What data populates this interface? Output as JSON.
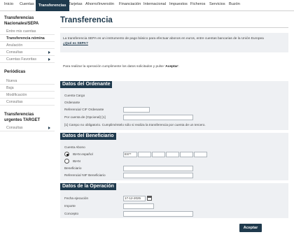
{
  "topnav": {
    "items": [
      "Inicio",
      "Cuentas",
      "Transferencias",
      "Tarjetas",
      "Ahorro/Inversión",
      "Financiación",
      "Internacional",
      "Impuestos",
      "Ficheros",
      "Servicios",
      "Buzón"
    ],
    "active": "Transferencias"
  },
  "sidebar": {
    "group1_title": "Transferencias Nacionales/SEPA",
    "group1_items": [
      "Entre mis cuentas",
      "Transferencia nómina",
      "Anulación",
      "Consultas",
      "Cuentas Favoritas"
    ],
    "group2_title": "Periódicas",
    "group2_items": [
      "Nueva",
      "Baja",
      "Modificación",
      "Consultas"
    ],
    "group3_title": "Transferencias urgentes TARGET",
    "group3_items": [
      "Consultas"
    ]
  },
  "main": {
    "title": "Transferencia",
    "info_text": "La transferencia SEPA es un instrumento de pago básico para efectuar abonos en euros, entre cuentas bancarias de la Unión Europea",
    "info_link": "¿Qué es SEPA?",
    "instruction_prefix": "Para realizar la operación cumplimente los datos solicitados y pulse ",
    "instruction_action": "Aceptar"
  },
  "ordenante": {
    "heading": "Datos del Ordenante",
    "cuenta_cargo_label": "Cuenta Cargo",
    "ordenante_label": "Ordenante",
    "referencia_label": "Referencia/ CIF Ordenante",
    "por_cuenta_label": "Por cuenta de (Opcional) [1]",
    "note": "[1] Campo no obligatorio. Cumpliméntelo sólo si realiza la transferencia por cuenta de un tercero."
  },
  "beneficiario": {
    "heading": "Datos del Beneficiario",
    "cuenta_abono_label": "Cuenta Abono",
    "iban_es_label": "IBAN español",
    "iban_label": "IBAN",
    "iban_prefix": "ES**",
    "beneficiario_label": "Beneficiario",
    "referencia_label": "Referencia/ NIF Beneficiario"
  },
  "operacion": {
    "heading": "Datos de la Operación",
    "fecha_label": "Fecha ejecución",
    "fecha_value": "17-12-2025",
    "importe_label": "Importe",
    "concepto_label": "Concepto"
  },
  "buttons": {
    "accept": "Aceptar"
  }
}
